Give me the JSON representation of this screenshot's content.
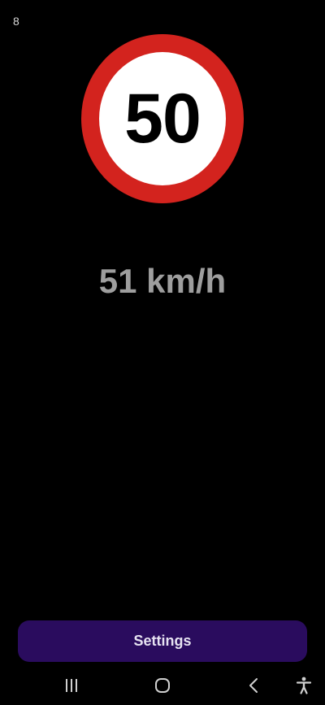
{
  "status_bar": {
    "left_text": "8"
  },
  "speed_sign": {
    "limit": "50",
    "ring_color": "#d3231e",
    "icon": "speed-limit-sign"
  },
  "current_speed": {
    "text": "51 km/h"
  },
  "settings_button": {
    "label": "Settings",
    "color": "#2a0c5e"
  },
  "nav_bar": {
    "items": [
      {
        "icon": "recent-apps-icon"
      },
      {
        "icon": "home-icon"
      },
      {
        "icon": "back-icon"
      },
      {
        "icon": "accessibility-icon"
      }
    ]
  }
}
